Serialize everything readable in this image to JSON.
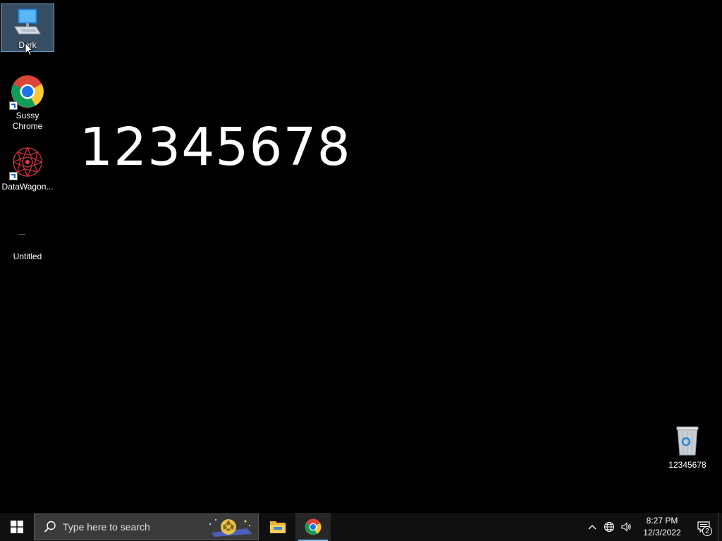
{
  "desktop": {
    "big_text": "12345678",
    "icons": [
      {
        "label": "Dark",
        "icon": "computer-icon"
      },
      {
        "label": "Sussy\nChrome",
        "icon": "chrome-icon"
      },
      {
        "label": "DataWagon...",
        "icon": "datawagon-icon"
      },
      {
        "label": "Untitled",
        "icon": "blank-file-icon"
      },
      {
        "label": "12345678",
        "icon": "recycle-bin-icon"
      }
    ]
  },
  "taskbar": {
    "search_placeholder": "Type here to search",
    "apps": [
      "file-explorer-icon",
      "chrome-icon"
    ],
    "clock_time": "8:27 PM",
    "clock_date": "12/3/2022",
    "notification_count": "2"
  },
  "colors": {
    "taskbar_bg": "#101010",
    "search_bg": "#3a3a3a",
    "accent": "#76b9ed"
  }
}
